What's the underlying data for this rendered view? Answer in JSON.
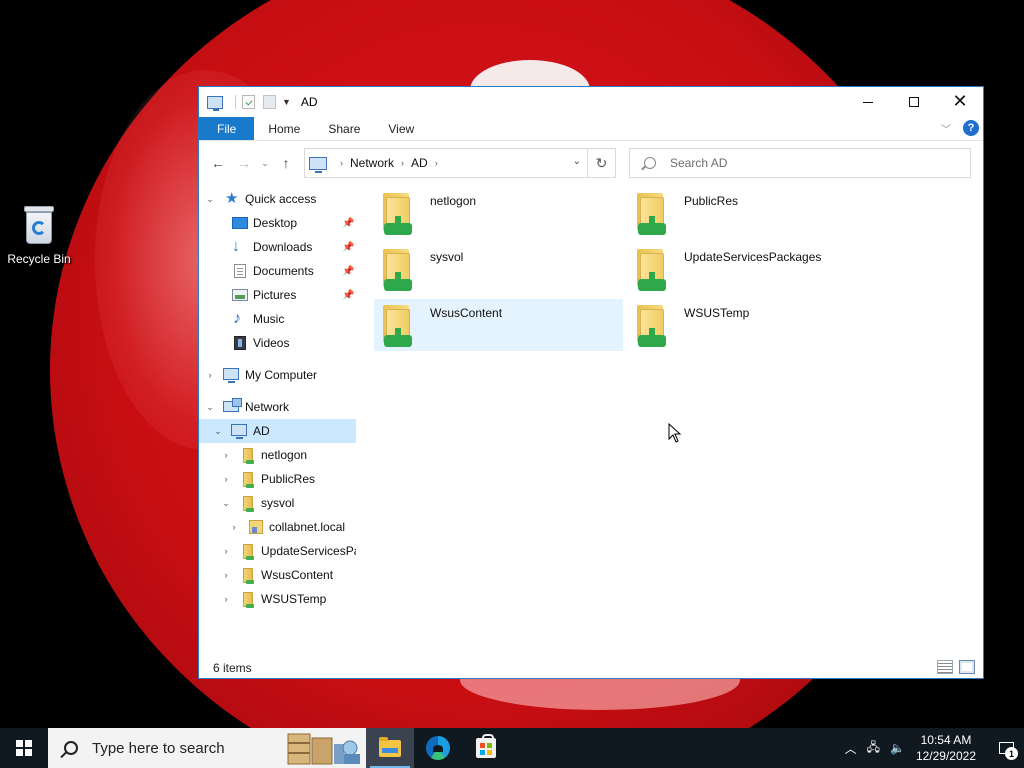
{
  "desktop": {
    "icons": [
      {
        "label": "Recycle Bin",
        "icon": "recycle-bin-icon"
      }
    ]
  },
  "window": {
    "title": "AD",
    "ribbon_tabs": [
      {
        "label": "File",
        "active": true
      },
      {
        "label": "Home"
      },
      {
        "label": "Share"
      },
      {
        "label": "View"
      }
    ],
    "help": "?",
    "address": {
      "crumbs": [
        "Network",
        "AD"
      ]
    },
    "search": {
      "placeholder": "Search AD"
    },
    "nav_tree": [
      {
        "label": "Quick access",
        "icon": "star-icon",
        "expanded": true
      },
      {
        "label": "Desktop",
        "icon": "desktop-icon",
        "pinned": true
      },
      {
        "label": "Downloads",
        "icon": "download-icon",
        "pinned": true
      },
      {
        "label": "Documents",
        "icon": "documents-icon",
        "pinned": true
      },
      {
        "label": "Pictures",
        "icon": "pictures-icon",
        "pinned": true
      },
      {
        "label": "Music",
        "icon": "music-icon"
      },
      {
        "label": "Videos",
        "icon": "videos-icon"
      },
      {
        "label": "My Computer",
        "icon": "computer-icon",
        "expanded": false
      },
      {
        "label": "Network",
        "icon": "network-icon",
        "expanded": true
      },
      {
        "label": "AD",
        "icon": "computer-icon",
        "expanded": true,
        "selected": true
      },
      {
        "label": "netlogon",
        "icon": "share-folder-icon"
      },
      {
        "label": "PublicRes",
        "icon": "share-folder-icon"
      },
      {
        "label": "sysvol",
        "icon": "share-folder-icon",
        "expanded": true
      },
      {
        "label": "collabnet.local",
        "icon": "folder-icon"
      },
      {
        "label": "UpdateServicesPackages",
        "icon": "share-folder-icon"
      },
      {
        "label": "WsusContent",
        "icon": "share-folder-icon"
      },
      {
        "label": "WSUSTemp",
        "icon": "share-folder-icon"
      }
    ],
    "items": [
      {
        "name": "netlogon"
      },
      {
        "name": "PublicRes"
      },
      {
        "name": "sysvol"
      },
      {
        "name": "UpdateServicesPackages"
      },
      {
        "name": "WsusContent",
        "hovered": true
      },
      {
        "name": "WSUSTemp"
      }
    ],
    "status": {
      "item_count": "6 items"
    }
  },
  "taskbar": {
    "search_placeholder": "Type here to search",
    "apps": [
      {
        "name": "File Explorer",
        "icon": "file-explorer-icon",
        "active": true
      },
      {
        "name": "Microsoft Edge",
        "icon": "edge-icon"
      },
      {
        "name": "Microsoft Store",
        "icon": "store-icon"
      }
    ],
    "clock": {
      "time": "10:54 AM",
      "date": "12/29/2022"
    },
    "notifications": {
      "count": "1"
    }
  },
  "colors": {
    "accent": "#1979ca",
    "selection": "#cce8ff",
    "hover": "#e5f3ff",
    "taskbar": "#101820",
    "wallpaper": "#c80e13"
  }
}
